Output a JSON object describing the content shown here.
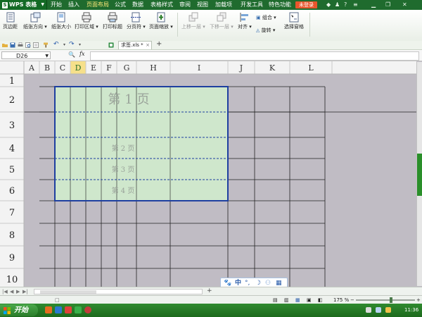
{
  "menubar": {
    "app_title": "WPS 表格",
    "items": [
      "开始",
      "插入",
      "页面布局",
      "公式",
      "数据",
      "表格样式",
      "审阅",
      "视图",
      "加载项",
      "开发工具",
      "特色功能"
    ],
    "login": "未登录"
  },
  "ribbon": {
    "buttons": [
      "页边距",
      "纸张方向",
      "纸张大小",
      "打印区域",
      "打印标题",
      "分页符",
      "页面缩放"
    ],
    "disabled": [
      "上移一层",
      "下移一层"
    ],
    "align": "对齐",
    "group": "组合",
    "rotate": "旋转",
    "selection_pane": "选择窗格"
  },
  "toolbar": {
    "file_tab": "求签.xls *",
    "close": "×",
    "new_tab": "+"
  },
  "formula_bar": {
    "name_box": "D26",
    "fx": "fx"
  },
  "grid": {
    "columns": [
      "A",
      "B",
      "C",
      "D",
      "E",
      "F",
      "G",
      "H",
      "I",
      "J",
      "K",
      "L"
    ],
    "rows": [
      "1",
      "2",
      "3",
      "4",
      "5",
      "6",
      "7",
      "8",
      "9",
      "10"
    ],
    "page_labels": [
      "第 1 页",
      "第 2 页",
      "第 3 页",
      "第 4 页"
    ]
  },
  "statusbar": {
    "zoom": "175 %",
    "plus": "+"
  },
  "ime": {
    "lang": "中"
  },
  "taskbar": {
    "start": "开始",
    "clock": "11:36"
  },
  "colors": {
    "page_fill": "#cfe7cc",
    "page_border": "#1e3fa0",
    "accent": "#1f6b2e"
  }
}
